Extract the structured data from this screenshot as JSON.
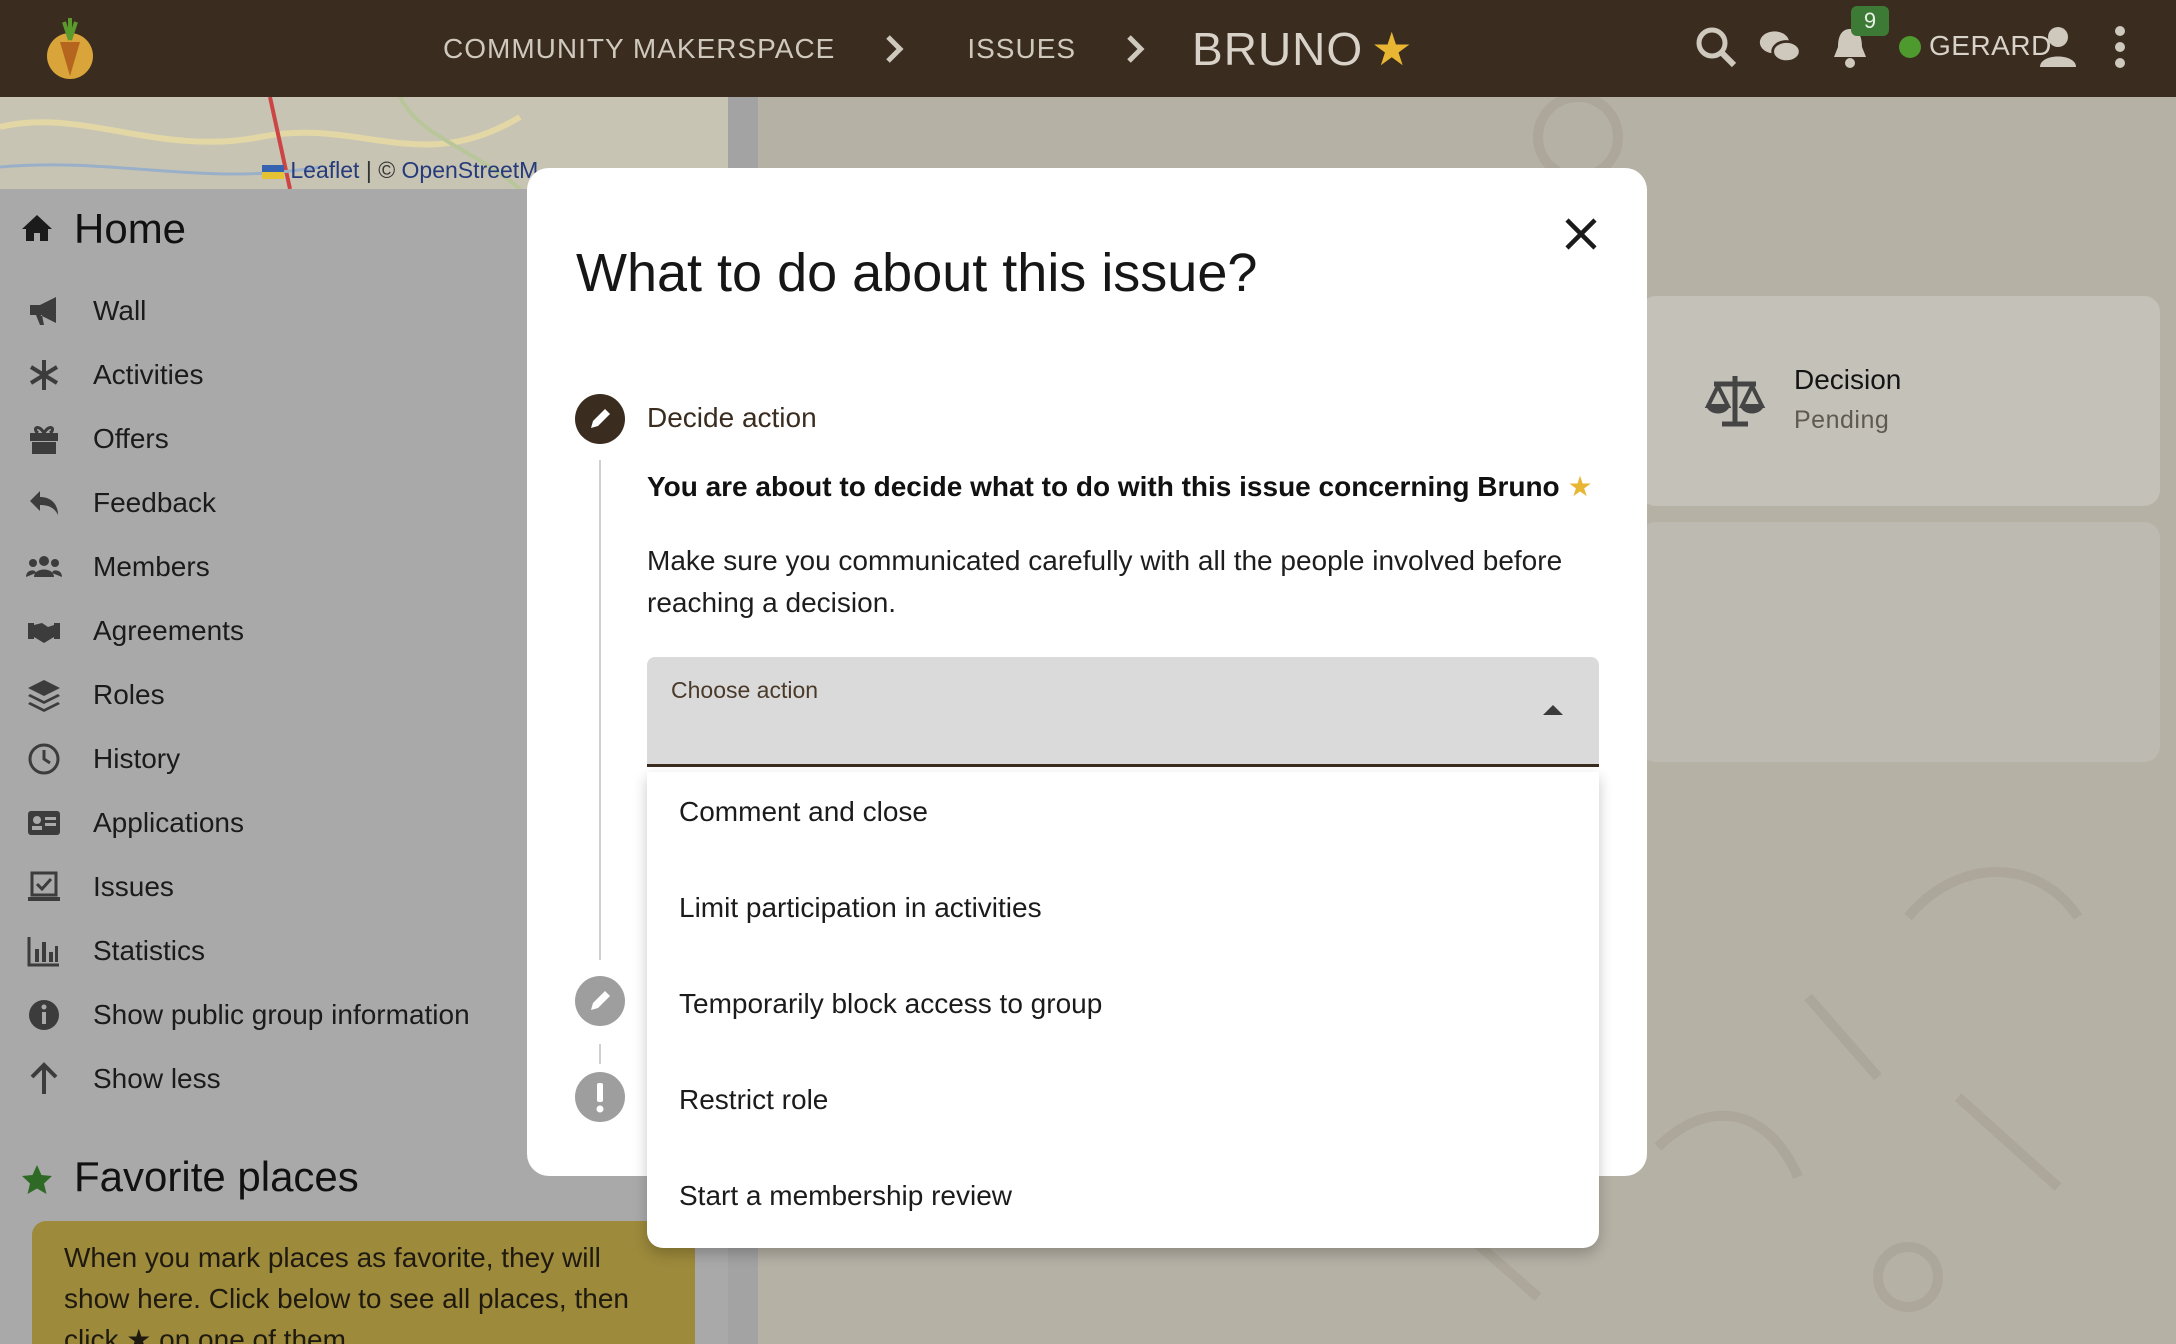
{
  "topbar": {
    "breadcrumbs": [
      "COMMUNITY MAKERSPACE",
      "ISSUES"
    ],
    "current": "BRUNO",
    "notifications_count": "9",
    "username": "GERARD"
  },
  "map": {
    "attribution_leaflet": "Leaflet",
    "attribution_sep": " | © ",
    "attribution_osm": "OpenStreetM"
  },
  "sidebar": {
    "home_title": "Home",
    "items": [
      {
        "label": "Wall",
        "icon": "megaphone-icon"
      },
      {
        "label": "Activities",
        "icon": "asterisk-icon"
      },
      {
        "label": "Offers",
        "icon": "gift-icon"
      },
      {
        "label": "Feedback",
        "icon": "reply-icon"
      },
      {
        "label": "Members",
        "icon": "users-icon"
      },
      {
        "label": "Agreements",
        "icon": "handshake-icon"
      },
      {
        "label": "Roles",
        "icon": "layers-icon"
      },
      {
        "label": "History",
        "icon": "clock-icon"
      },
      {
        "label": "Applications",
        "icon": "id-card-icon"
      },
      {
        "label": "Issues",
        "icon": "inbox-check-icon"
      },
      {
        "label": "Statistics",
        "icon": "bar-chart-icon"
      },
      {
        "label": "Show public group information",
        "icon": "info-icon"
      },
      {
        "label": "Show less",
        "icon": "arrow-up-icon"
      }
    ],
    "favorites_title": "Favorite places",
    "favorites_note_1": "When you mark places as favorite, they will",
    "favorites_note_2": "show here. Click below to see all places, then",
    "favorites_note_3_a": "click ",
    "favorites_note_3_b": " on one of them"
  },
  "main": {
    "decision_title": "Decision",
    "decision_status": "Pending"
  },
  "modal": {
    "title": "What to do about this issue?",
    "step1_label": "Decide action",
    "bold_line": "You are about to decide what to do with this issue concerning Bruno",
    "info_line_1": "Make sure you communicated carefully with all the people involved before",
    "info_line_2": "reaching a decision.",
    "select_label": "Choose action",
    "options": [
      "Comment and close",
      "Limit participation in activities",
      "Temporarily block access to group",
      "Restrict role",
      "Start a membership review"
    ]
  },
  "colors": {
    "topbar": "#3a2c1f",
    "accent": "#3a2c1f",
    "badge": "#3d7a36",
    "online": "#4e9a2e",
    "favorite_note": "#9d8a3b"
  }
}
